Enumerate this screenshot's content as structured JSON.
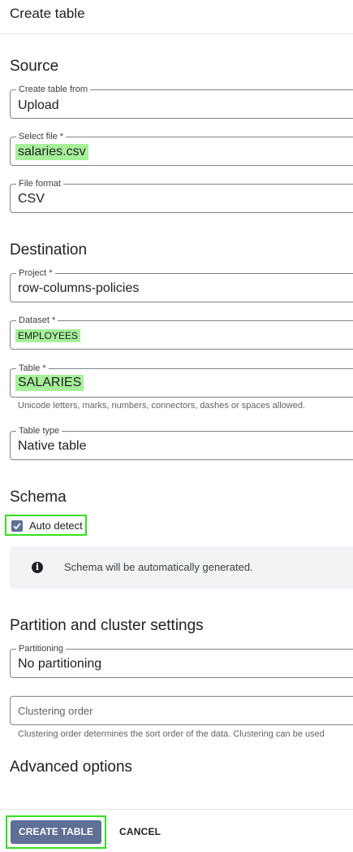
{
  "header": {
    "title": "Create table"
  },
  "source": {
    "title": "Source",
    "create_from": {
      "label": "Create table from",
      "value": "Upload"
    },
    "select_file": {
      "label": "Select file *",
      "value": "salaries.csv"
    },
    "file_format": {
      "label": "File format",
      "value": "CSV"
    }
  },
  "destination": {
    "title": "Destination",
    "project": {
      "label": "Project *",
      "value": "row-columns-policies"
    },
    "dataset": {
      "label": "Dataset *",
      "value": "EMPLOYEES"
    },
    "table": {
      "label": "Table *",
      "value": "SALARIES",
      "hint": "Unicode letters, marks, numbers, connectors, dashes or spaces allowed."
    },
    "table_type": {
      "label": "Table type",
      "value": "Native table"
    }
  },
  "schema": {
    "title": "Schema",
    "auto_detect_label": "Auto detect",
    "auto_detect_checked": true,
    "info_icon": "info-icon",
    "info_text": "Schema will be automatically generated."
  },
  "partition": {
    "title": "Partition and cluster settings",
    "partitioning": {
      "label": "Partitioning",
      "value": "No partitioning"
    },
    "clustering": {
      "placeholder": "Clustering order",
      "hint": "Clustering order determines the sort order of the data. Clustering can be used"
    }
  },
  "advanced": {
    "title": "Advanced options"
  },
  "footer": {
    "create_label": "CREATE TABLE",
    "cancel_label": "CANCEL"
  },
  "colors": {
    "primary_button": "#5f6f95",
    "highlight": "#a6f09a",
    "focus_outline": "#35e01d"
  }
}
